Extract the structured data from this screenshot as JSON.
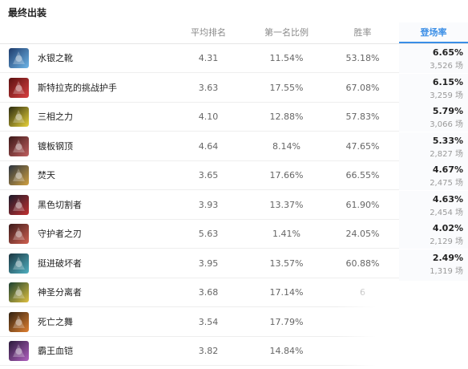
{
  "title": "最终出装",
  "columns": [
    "平均排名",
    "第一名比例",
    "胜率",
    "登场率"
  ],
  "accent": "#3a8ee6",
  "rows": [
    {
      "name": "水银之靴",
      "avg": "4.31",
      "first": "11.54%",
      "win": "53.18%",
      "rate": "6.65%",
      "count": "3,526 场",
      "icon": "boots-icon",
      "c1": "#1d3a6b",
      "c2": "#6fb6e8"
    },
    {
      "name": "斯特拉克的挑战护手",
      "avg": "3.63",
      "first": "17.55%",
      "win": "67.08%",
      "rate": "6.15%",
      "count": "3,259 场",
      "icon": "gauntlet-icon",
      "c1": "#5a1010",
      "c2": "#d94040"
    },
    {
      "name": "三相之力",
      "avg": "4.10",
      "first": "12.88%",
      "win": "57.83%",
      "rate": "5.79%",
      "count": "3,066 场",
      "icon": "triforce-icon",
      "c1": "#2a2a10",
      "c2": "#e8d23a"
    },
    {
      "name": "镀板钢顶",
      "avg": "4.64",
      "first": "8.14%",
      "win": "47.65%",
      "rate": "5.33%",
      "count": "2,827 场",
      "icon": "helmet-icon",
      "c1": "#3a1818",
      "c2": "#c06060"
    },
    {
      "name": "焚天",
      "avg": "3.65",
      "first": "17.66%",
      "win": "66.55%",
      "rate": "4.67%",
      "count": "2,475 场",
      "icon": "sword-icon",
      "c1": "#2a3340",
      "c2": "#d0a040"
    },
    {
      "name": "黑色切割者",
      "avg": "3.93",
      "first": "13.37%",
      "win": "61.90%",
      "rate": "4.63%",
      "count": "2,454 场",
      "icon": "axe-icon",
      "c1": "#1a1a2a",
      "c2": "#c03030"
    },
    {
      "name": "守护者之刃",
      "avg": "5.63",
      "first": "1.41%",
      "win": "24.05%",
      "rate": "4.02%",
      "count": "2,129 场",
      "icon": "blade-icon",
      "c1": "#3a1a1a",
      "c2": "#d06050"
    },
    {
      "name": "挺进破坏者",
      "avg": "3.95",
      "first": "13.57%",
      "win": "60.88%",
      "rate": "2.49%",
      "count": "1,319 场",
      "icon": "breaker-icon",
      "c1": "#1a3540",
      "c2": "#50b0c0"
    },
    {
      "name": "神圣分离者",
      "avg": "3.68",
      "first": "17.14%",
      "win": "6",
      "rate": "",
      "count": "",
      "icon": "divine-icon",
      "c1": "#1a4030",
      "c2": "#e0c040"
    },
    {
      "name": "死亡之舞",
      "avg": "3.54",
      "first": "17.79%",
      "win": "",
      "rate": "",
      "count": "",
      "icon": "dance-icon",
      "c1": "#302010",
      "c2": "#e08030"
    },
    {
      "name": "霸王血铠",
      "avg": "3.82",
      "first": "14.84%",
      "win": "",
      "rate": "",
      "count": "",
      "icon": "armor-icon",
      "c1": "#2a1a3a",
      "c2": "#b060c0"
    }
  ]
}
